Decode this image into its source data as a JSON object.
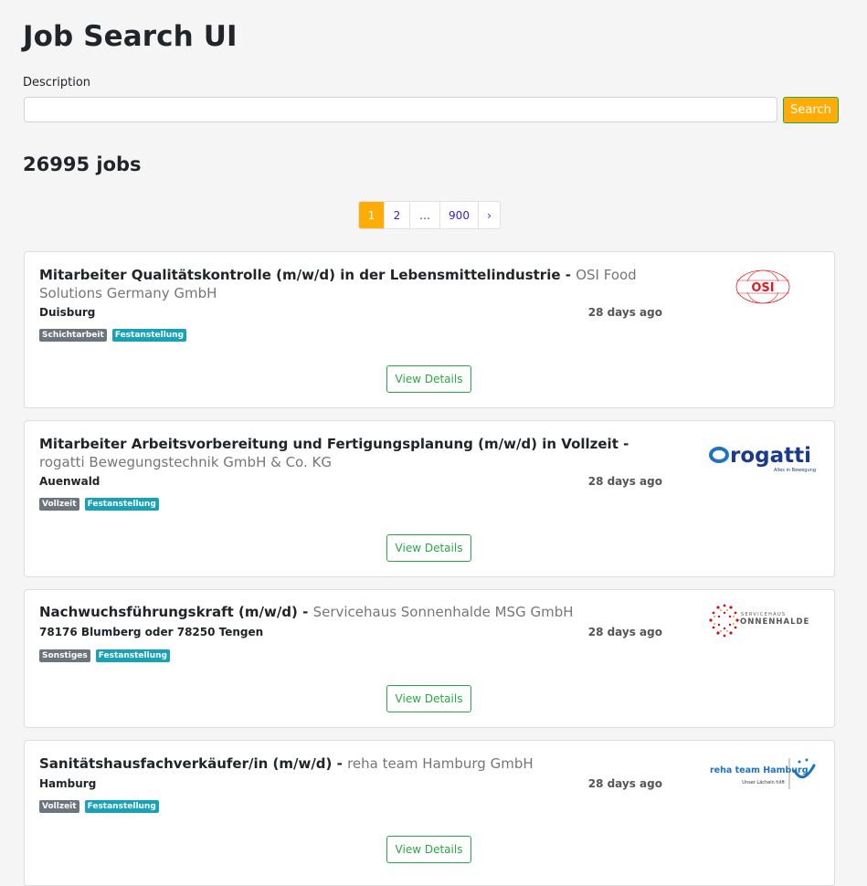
{
  "header": {
    "title": "Job Search UI"
  },
  "search": {
    "label": "Description",
    "value": "",
    "placeholder": "",
    "button_label": "Search"
  },
  "results": {
    "count_text": "26995 jobs"
  },
  "pagination": {
    "pages": [
      "1",
      "2",
      "…",
      "900",
      "›"
    ],
    "active": "1"
  },
  "jobs": [
    {
      "title": "Mitarbeiter Qualitätskontrolle (m/w/d) in der Lebensmittelindustrie",
      "separator": " - ",
      "company": "OSI Food Solutions Germany GmbH",
      "location": "Duisburg",
      "age": "28 days ago",
      "tags": [
        "Schichtarbeit",
        "Festanstellung"
      ],
      "button": "View Details",
      "logo": {
        "text": "OSI",
        "color": "#e31b23"
      }
    },
    {
      "title": "Mitarbeiter Arbeitsvorbereitung und Fertigungsplanung (m/w/d) in Vollzeit",
      "separator": " - ",
      "company": "rogatti Bewegungstechnik GmbH & Co. KG",
      "location": "Auenwald",
      "age": "28 days ago",
      "tags": [
        "Vollzeit",
        "Festanstellung"
      ],
      "button": "View Details",
      "logo": {
        "text": "rogatti",
        "subtext": "Alles in Bewegung",
        "color": "#1a3a8a"
      }
    },
    {
      "title": "Nachwuchsführungskraft (m/w/d)",
      "separator": " - ",
      "company": "Servicehaus Sonnenhalde MSG GmbH",
      "location": "78176 Blumberg oder 78250 Tengen",
      "age": "28 days ago",
      "tags": [
        "Sonstiges",
        "Festanstellung"
      ],
      "button": "View Details",
      "logo": {
        "text": "ONNENHALDE",
        "pretext": "SERVICEHAUS",
        "color": "#c8102e"
      }
    },
    {
      "title": "Sanitätshausfachverkäufer/in (m/w/d)",
      "separator": " - ",
      "company": "reha team Hamburg GmbH",
      "location": "Hamburg",
      "age": "28 days ago",
      "tags": [
        "Vollzeit",
        "Festanstellung"
      ],
      "button": "View Details",
      "logo": {
        "text": "reha team Hamburg",
        "subtext": "Unser Lächeln hilft",
        "color": "#1e73be"
      }
    }
  ],
  "colors": {
    "accent": "#ffad06",
    "success": "#28a745",
    "info": "#17a2b8",
    "secondary": "#6c757d"
  }
}
